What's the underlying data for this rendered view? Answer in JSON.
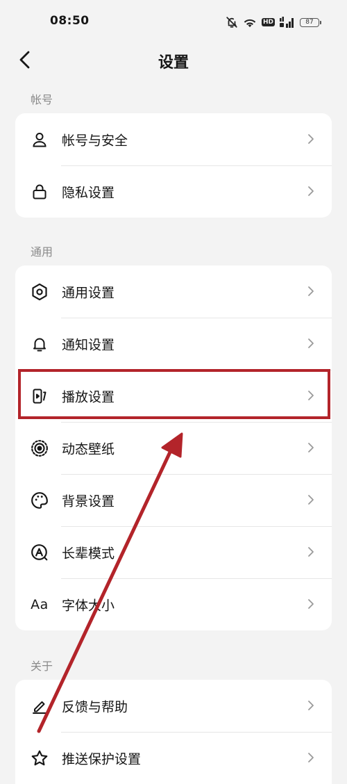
{
  "status_bar": {
    "time": "08:50",
    "hd_label": "HD",
    "battery_level": "87",
    "icons": [
      "mute-bell-icon",
      "wifi-icon",
      "hd-icon",
      "cellular-signal-icon",
      "battery-icon"
    ]
  },
  "nav": {
    "title": "设置",
    "back_icon": "chevron-left-icon"
  },
  "sections": {
    "account": {
      "label": "帐号",
      "items": [
        {
          "label": "帐号与安全",
          "icon": "user-icon"
        },
        {
          "label": "隐私设置",
          "icon": "lock-icon"
        }
      ]
    },
    "general": {
      "label": "通用",
      "items": [
        {
          "label": "通用设置",
          "icon": "gear-icon"
        },
        {
          "label": "通知设置",
          "icon": "bell-icon"
        },
        {
          "label": "播放设置",
          "icon": "playback-icon"
        },
        {
          "label": "动态壁纸",
          "icon": "live-wallpaper-icon"
        },
        {
          "label": "背景设置",
          "icon": "palette-icon"
        },
        {
          "label": "长辈模式",
          "icon": "elder-mode-icon"
        },
        {
          "label": "字体大小",
          "icon": "font-size-icon",
          "glyph": "Aa"
        }
      ]
    },
    "about": {
      "label": "关于",
      "items": [
        {
          "label": "反馈与帮助",
          "icon": "pencil-icon"
        },
        {
          "label": "推送保护设置",
          "icon": "star-icon"
        }
      ]
    }
  },
  "annotation": {
    "color": "#b3242a",
    "highlighted_item": "播放设置"
  },
  "colors": {
    "background": "#f3f3f3",
    "card": "#ffffff",
    "text": "#161616",
    "section_label": "#8a8a8a",
    "chevron": "#9a9a9a"
  }
}
